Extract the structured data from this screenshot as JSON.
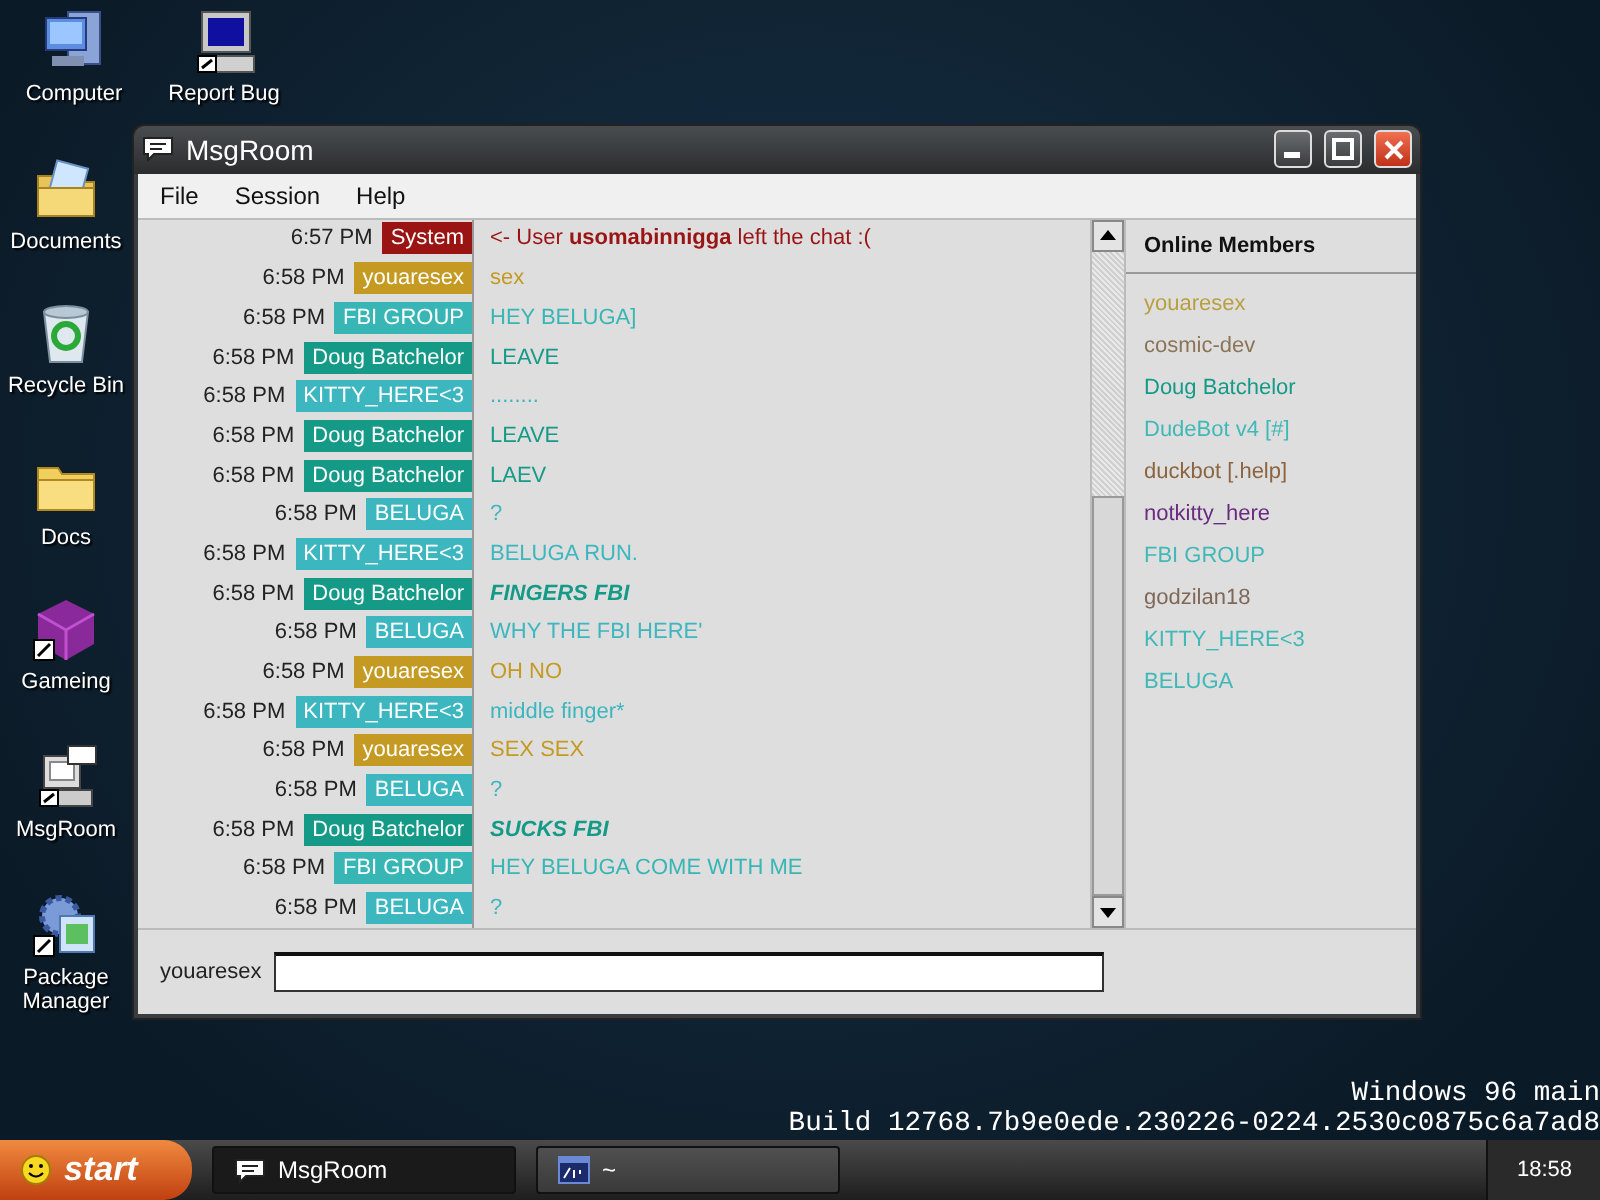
{
  "desktop_icons": [
    {
      "label": "Computer",
      "kind": "computer"
    },
    {
      "label": "Report Bug",
      "kind": "monitor"
    },
    {
      "label": "Documents",
      "kind": "documents"
    },
    {
      "label": "Recycle Bin",
      "kind": "recycle"
    },
    {
      "label": "Docs",
      "kind": "folder"
    },
    {
      "label": "Gameing",
      "kind": "cube"
    },
    {
      "label": "MsgRoom",
      "kind": "msgroom"
    },
    {
      "label": "Package Manager",
      "kind": "package"
    }
  ],
  "window": {
    "title": "MsgRoom"
  },
  "menu": [
    "File",
    "Session",
    "Help"
  ],
  "messages": [
    {
      "time": "6:57 PM",
      "user": "System",
      "color": "#9a1414",
      "text": "<- User **usomabinnigga** left the chat :(",
      "italic": false
    },
    {
      "time": "6:58 PM",
      "user": "youaresex",
      "color": "#c49a22",
      "text": "sex",
      "italic": false
    },
    {
      "time": "6:58 PM",
      "user": "FBI GROUP",
      "color": "#38b6b6",
      "text": "HEY BELUGA]",
      "italic": false
    },
    {
      "time": "6:58 PM",
      "user": "Doug Batchelor",
      "color": "#159a88",
      "text": "LEAVE",
      "italic": false
    },
    {
      "time": "6:58 PM",
      "user": "KITTY_HERE<3",
      "color": "#3cb6bf",
      "text": "........",
      "italic": false
    },
    {
      "time": "6:58 PM",
      "user": "Doug Batchelor",
      "color": "#159a88",
      "text": "LEAVE",
      "italic": false
    },
    {
      "time": "6:58 PM",
      "user": "Doug Batchelor",
      "color": "#159a88",
      "text": "LAEV",
      "italic": false
    },
    {
      "time": "6:58 PM",
      "user": "BELUGA",
      "color": "#3cb6bf",
      "text": "?",
      "italic": false
    },
    {
      "time": "6:58 PM",
      "user": "KITTY_HERE<3",
      "color": "#3cb6bf",
      "text": "BELUGA RUN.",
      "italic": false
    },
    {
      "time": "6:58 PM",
      "user": "Doug Batchelor",
      "color": "#159a88",
      "text": "FINGERS FBI",
      "italic": true
    },
    {
      "time": "6:58 PM",
      "user": "BELUGA",
      "color": "#3cb6bf",
      "text": "WHY THE FBI HERE'",
      "italic": false
    },
    {
      "time": "6:58 PM",
      "user": "youaresex",
      "color": "#c49a22",
      "text": "OH NO",
      "italic": false
    },
    {
      "time": "6:58 PM",
      "user": "KITTY_HERE<3",
      "color": "#3cb6bf",
      "text": "middle finger*",
      "italic": false
    },
    {
      "time": "6:58 PM",
      "user": "youaresex",
      "color": "#c49a22",
      "text": "SEX SEX",
      "italic": false
    },
    {
      "time": "6:58 PM",
      "user": "BELUGA",
      "color": "#3cb6bf",
      "text": "?",
      "italic": false
    },
    {
      "time": "6:58 PM",
      "user": "Doug Batchelor",
      "color": "#159a88",
      "text": "SUCKS FBI",
      "italic": true
    },
    {
      "time": "6:58 PM",
      "user": "FBI GROUP",
      "color": "#38b6b6",
      "text": "HEY BELUGA COME WITH ME",
      "italic": false
    },
    {
      "time": "6:58 PM",
      "user": "BELUGA",
      "color": "#3cb6bf",
      "text": "?",
      "italic": false
    }
  ],
  "members": {
    "title": "Online Members",
    "items": [
      {
        "name": "youaresex",
        "color": "#b8a040"
      },
      {
        "name": "cosmic-dev",
        "color": "#8c7458"
      },
      {
        "name": "Doug Batchelor",
        "color": "#159a88"
      },
      {
        "name": "DudeBot v4 [#]",
        "color": "#40b8b8"
      },
      {
        "name": "duckbot [.help]",
        "color": "#8c6440"
      },
      {
        "name": "notkitty_here",
        "color": "#6a2a80"
      },
      {
        "name": "FBI GROUP",
        "color": "#40b8b8"
      },
      {
        "name": "godzilan18",
        "color": "#806858"
      },
      {
        "name": "KITTY_HERE<3",
        "color": "#40b8b8"
      },
      {
        "name": "BELUGA",
        "color": "#40b8b8"
      }
    ]
  },
  "input": {
    "nickname": "youaresex"
  },
  "watermark_lines": [
    "Windows 96 main",
    "Build 12768.7b9e0ede.230226-0224.2530c0875c6a7ad8"
  ],
  "taskbar": {
    "start": "start",
    "tasks": [
      {
        "label": "MsgRoom",
        "kind": "msgroom",
        "selected": true
      },
      {
        "label": "~",
        "kind": "terminal",
        "selected": false
      }
    ],
    "clock": "18:58"
  }
}
